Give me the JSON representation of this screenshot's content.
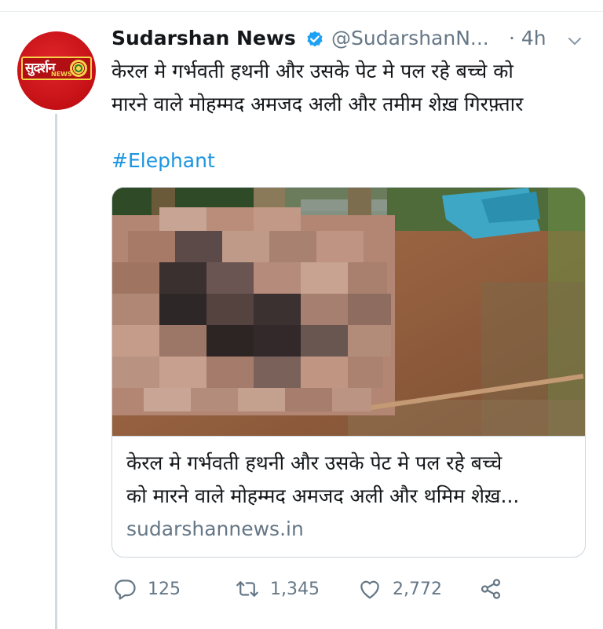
{
  "tweet": {
    "author": {
      "display_name": "Sudarshan News",
      "handle": "@SudarshanN...",
      "verified": true,
      "avatar_text": "सुदर्शन",
      "avatar_subtext": "NEWS"
    },
    "time": "· 4h",
    "text": "केरल मे गर्भवती हथनी और उसके पेट मे पल रहे बच्चे को\nमारने वाले मोहम्मद अमजद अली और तमीम शेख़ गिरफ़्तार",
    "hashtag": "#Elephant",
    "card": {
      "title": "केरल मे गर्भवती हथनी और उसके पेट मे पल रहे बच्चे\nको मारने वाले मोहम्मद अमजद अली और थमिम शेख़...",
      "domain": "sudarshannews.in"
    },
    "actions": {
      "reply_count": "125",
      "retweet_count": "1,345",
      "like_count": "2,772"
    }
  },
  "colors": {
    "link": "#1b95e0",
    "secondary_text": "#657786",
    "verified": "#1da1f2",
    "border": "#ccd6dd"
  },
  "icons": [
    "verified-badge-icon",
    "chevron-down-icon",
    "reply-icon",
    "retweet-icon",
    "like-icon",
    "share-icon"
  ]
}
